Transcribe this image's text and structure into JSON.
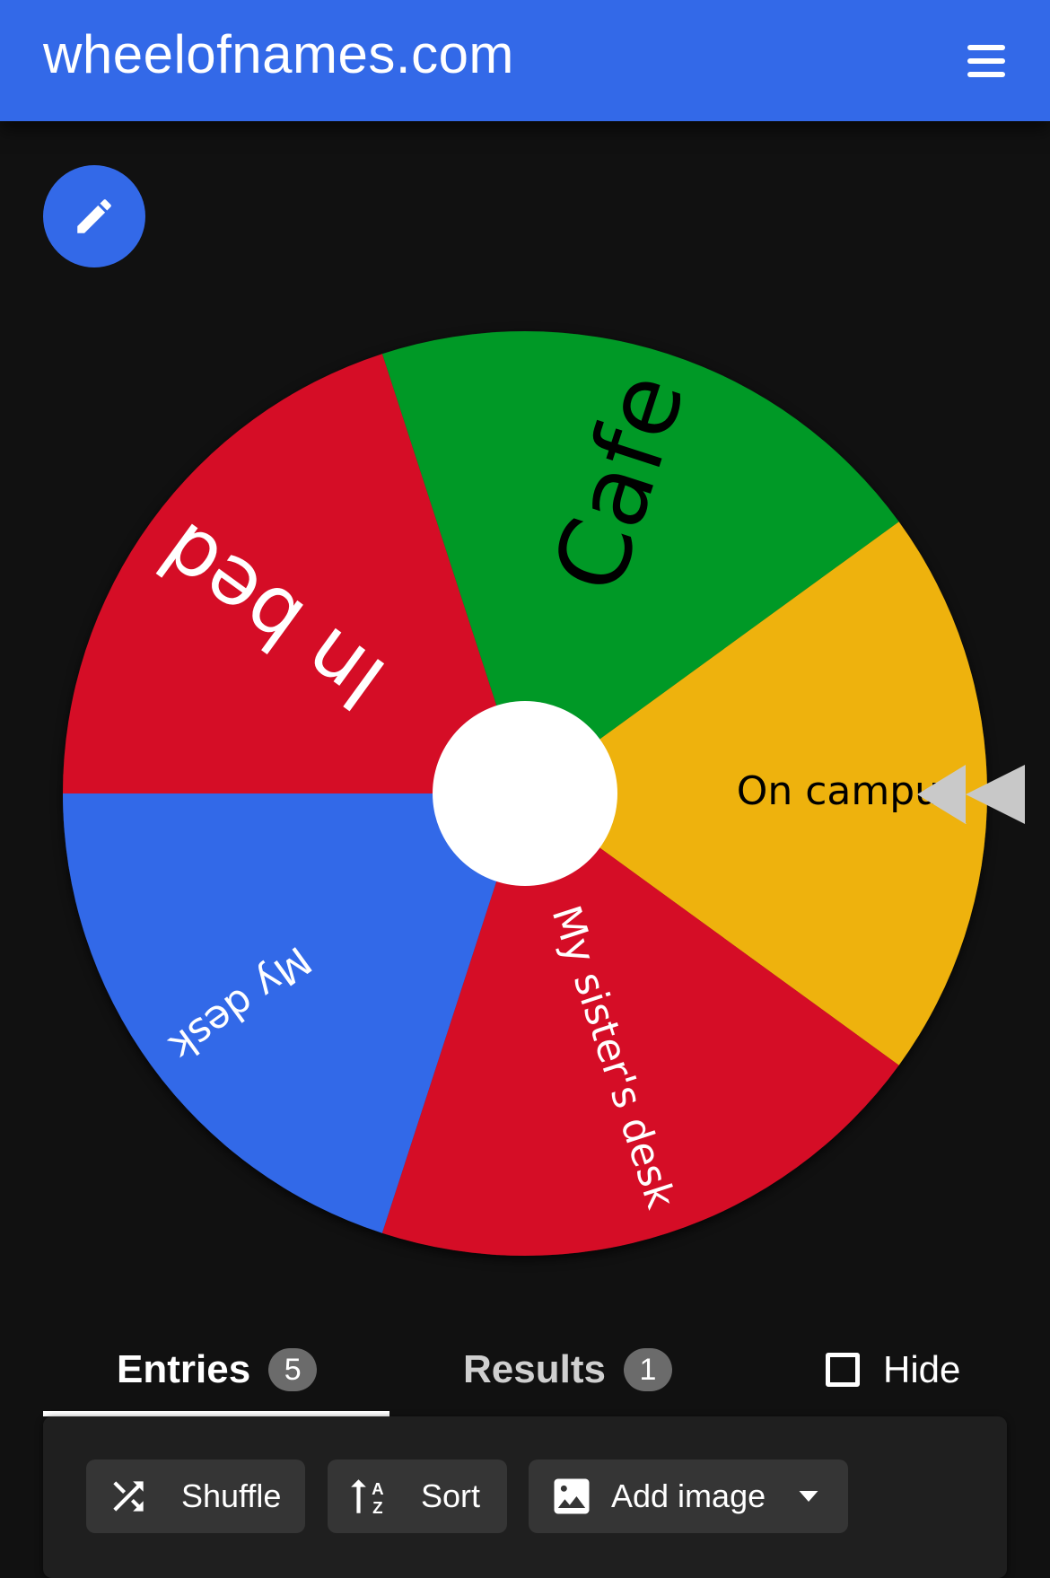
{
  "header": {
    "title": "wheelofnames.com",
    "menu_icon": "hamburger-menu-icon"
  },
  "edit_button": {
    "icon": "pencil-icon"
  },
  "wheel": {
    "segments": [
      {
        "label": "Cafe",
        "color": "#009925",
        "text_color": "#000000"
      },
      {
        "label": "On campus",
        "color": "#eeb211",
        "text_color": "#000000"
      },
      {
        "label": "My sister's desk",
        "color": "#d50f25",
        "text_color": "#ffffff"
      },
      {
        "label": "My desk",
        "color": "#3369e8",
        "text_color": "#ffffff"
      },
      {
        "label": "In bed",
        "color": "#d50f25",
        "text_color": "#ffffff"
      }
    ],
    "hub_color": "#ffffff",
    "pointer_color": "#c8c8c8"
  },
  "tabs": {
    "entries": {
      "label": "Entries",
      "count": "5"
    },
    "results": {
      "label": "Results",
      "count": "1"
    },
    "hide": {
      "label": "Hide",
      "checked": false
    }
  },
  "toolbar": {
    "shuffle_label": "Shuffle",
    "sort_label": "Sort",
    "add_image_label": "Add image"
  },
  "colors": {
    "brand_blue": "#3369e8",
    "background": "#111111"
  }
}
